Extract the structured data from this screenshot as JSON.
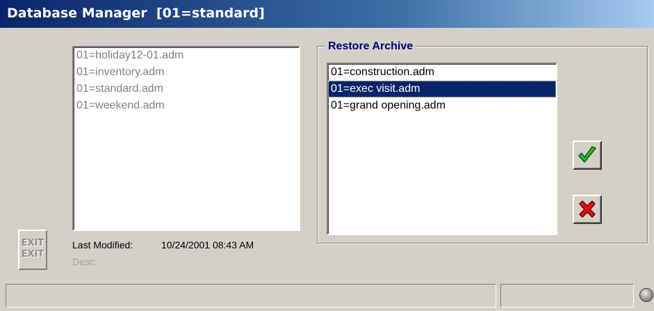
{
  "window": {
    "title": "Database Manager  [01=standard]"
  },
  "database_list": {
    "items": [
      "01=holiday12-01.adm",
      "01=inventory.adm",
      "01=standard.adm",
      "01=weekend.adm"
    ]
  },
  "exit_button": {
    "line1": "EXIT",
    "line2": "EXIT"
  },
  "details": {
    "last_modified_label": "Last Modified:",
    "last_modified_value": "10/24/2001 08:43 AM",
    "desc_label": "Desc:"
  },
  "restore_archive": {
    "title": "Restore Archive",
    "items": [
      "01=construction.adm",
      "01=exec visit.adm",
      "01=grand opening.adm"
    ],
    "selected_index": 1
  },
  "buttons": {
    "ok_icon": "checkmark-icon",
    "cancel_icon": "x-icon"
  },
  "status_bar": {
    "left_text": "",
    "right_text": "",
    "indicator_icon": "status-led-icon"
  },
  "colors": {
    "title_bar": "#0a246a",
    "selection": "#0a246a",
    "group_title": "#000080",
    "ok_green": "#2fb82f",
    "cancel_red": "#e01010"
  }
}
